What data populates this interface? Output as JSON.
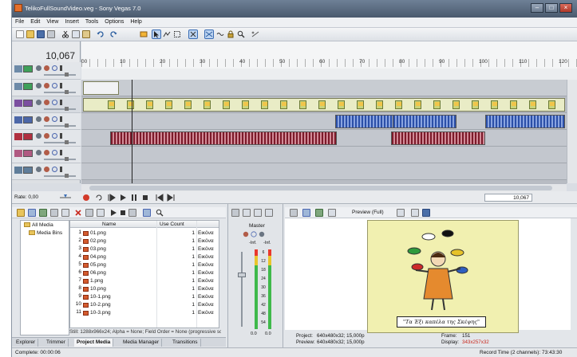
{
  "window": {
    "title": "TelikoFullSoundVideo.veg - Sony Vegas 7.0"
  },
  "menu": [
    "File",
    "Edit",
    "View",
    "Insert",
    "Tools",
    "Options",
    "Help"
  ],
  "timeline": {
    "timecode": "10,067",
    "ruler_labels": [
      "00",
      "10",
      "20",
      "30",
      "40",
      "50",
      "60",
      "70",
      "80",
      "90",
      "100",
      "110",
      "120"
    ],
    "rate": "Rate: 0,00",
    "cursor_time": "10,067"
  },
  "project_media": {
    "tree": [
      "All Media",
      "Media Bins"
    ],
    "columns": {
      "name": "Name",
      "use_count": "Use Count"
    },
    "files": [
      {
        "n": "1",
        "name": "01.png",
        "uses": "1",
        "type": "Εικόνα"
      },
      {
        "n": "2",
        "name": "02.png",
        "uses": "1",
        "type": "Εικόνα"
      },
      {
        "n": "3",
        "name": "03.png",
        "uses": "1",
        "type": "Εικόνα"
      },
      {
        "n": "4",
        "name": "04.png",
        "uses": "1",
        "type": "Εικόνα"
      },
      {
        "n": "5",
        "name": "05.png",
        "uses": "1",
        "type": "Εικόνα"
      },
      {
        "n": "6",
        "name": "06.png",
        "uses": "1",
        "type": "Εικόνα"
      },
      {
        "n": "7",
        "name": "1.png",
        "uses": "1",
        "type": "Εικόνα"
      },
      {
        "n": "8",
        "name": "10.png",
        "uses": "1",
        "type": "Εικόνα"
      },
      {
        "n": "9",
        "name": "10-1.png",
        "uses": "1",
        "type": "Εικόνα"
      },
      {
        "n": "10",
        "name": "10-2.png",
        "uses": "1",
        "type": "Εικόνα"
      },
      {
        "n": "11",
        "name": "10-3.png",
        "uses": "1",
        "type": "Εικόνα"
      }
    ],
    "status": "Still: 1288x966x24; Alpha = None; Field Order = None (progressive sca"
  },
  "tabs": [
    "Explorer",
    "Trimmer",
    "Project Media",
    "Media Manager",
    "Transitions"
  ],
  "mixer": {
    "title": "Master",
    "db_left": "-Inf.",
    "db_right": "-Inf.",
    "scale": [
      "6",
      "12",
      "18",
      "24",
      "30",
      "36",
      "42",
      "48",
      "54"
    ],
    "bottom_left": "0.0",
    "bottom_right": "0.0"
  },
  "preview": {
    "mode": "Preview (Full)",
    "caption": "\"Τα Έξι καπέλα της Σκέψης\"",
    "project_label": "Project:",
    "project_value": "640x480x32; 15,000p",
    "preview_label": "Preview:",
    "preview_value": "640x480x32; 15,000p",
    "frame_label": "Frame:",
    "frame_value": "151",
    "display_label": "Display:",
    "display_value": "343x257x32"
  },
  "status": {
    "complete": "Complete: 00:00:06",
    "record_time": "Record Time (2 channels): 73:43:30"
  },
  "colors": {
    "accent": "#3a6db5",
    "track_green": "#3fa05a",
    "track_purple": "#7b4fa0",
    "track_red": "#b03040"
  }
}
